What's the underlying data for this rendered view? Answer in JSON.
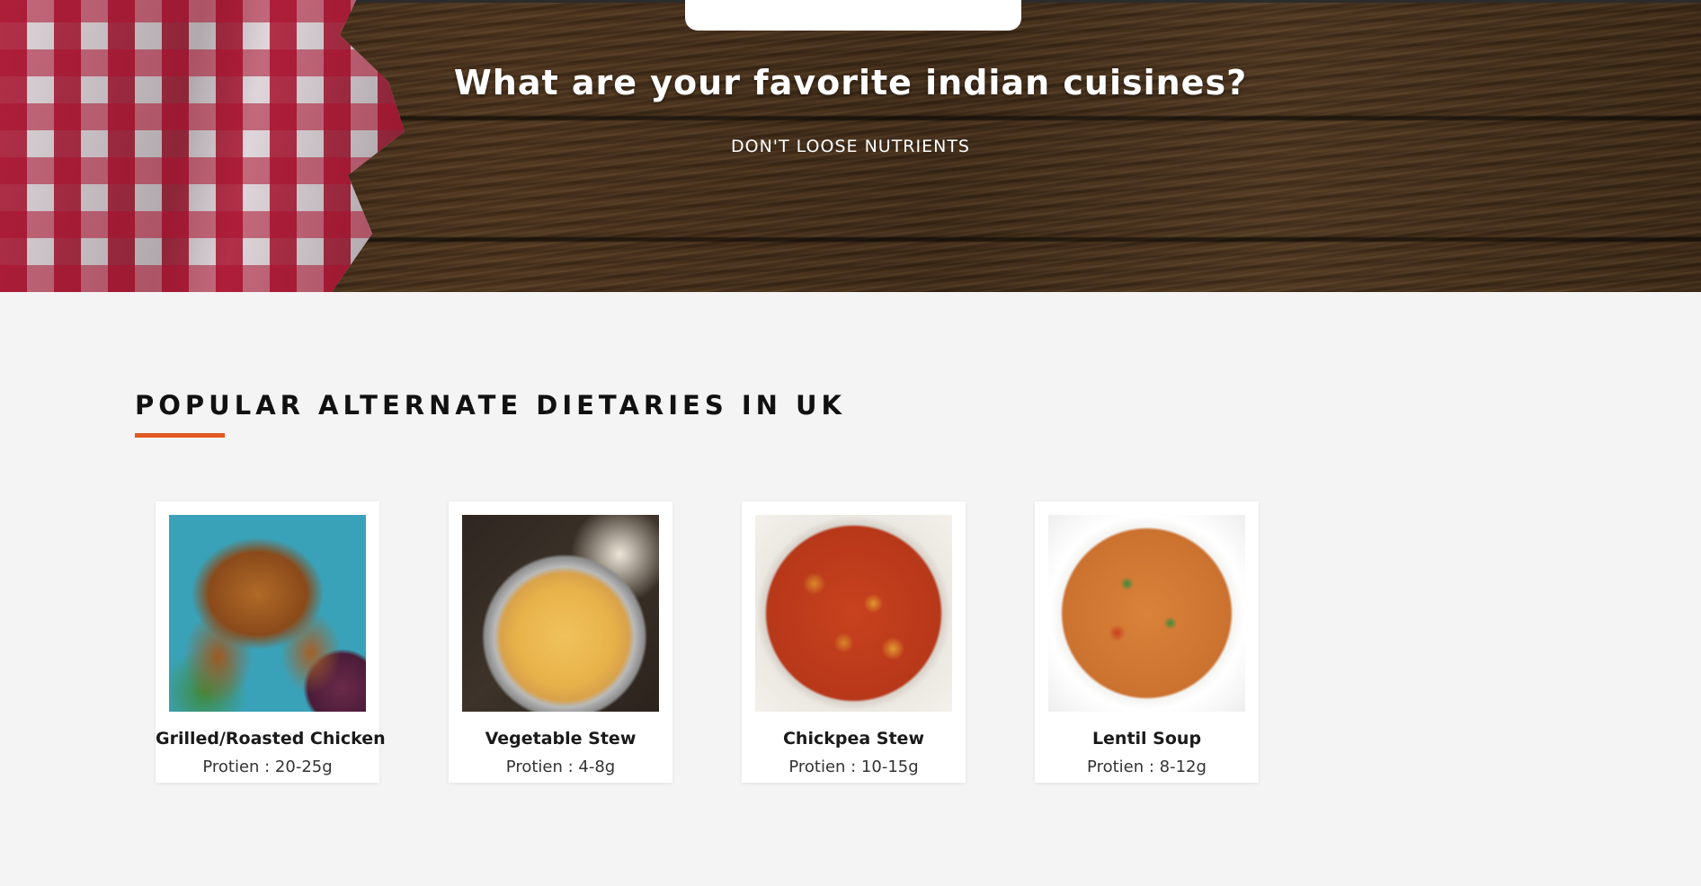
{
  "hero": {
    "title": "What are your favorite indian cuisines?",
    "subtitle": "DON'T LOOSE NUTRIENTS"
  },
  "section": {
    "heading": "POPULAR ALTERNATE DIETARIES IN UK",
    "accent_color": "#e2591f"
  },
  "cards": [
    {
      "name": "Grilled/Roasted Chicken",
      "protein": "Protien : 20-25g",
      "image": "grilled-chicken-photo"
    },
    {
      "name": "Vegetable Stew",
      "protein": "Protien : 4-8g",
      "image": "vegetable-stew-photo"
    },
    {
      "name": "Chickpea Stew",
      "protein": "Protien : 10-15g",
      "image": "chickpea-stew-photo"
    },
    {
      "name": "Lentil Soup",
      "protein": "Protien : 8-12g",
      "image": "lentil-soup-photo"
    }
  ]
}
